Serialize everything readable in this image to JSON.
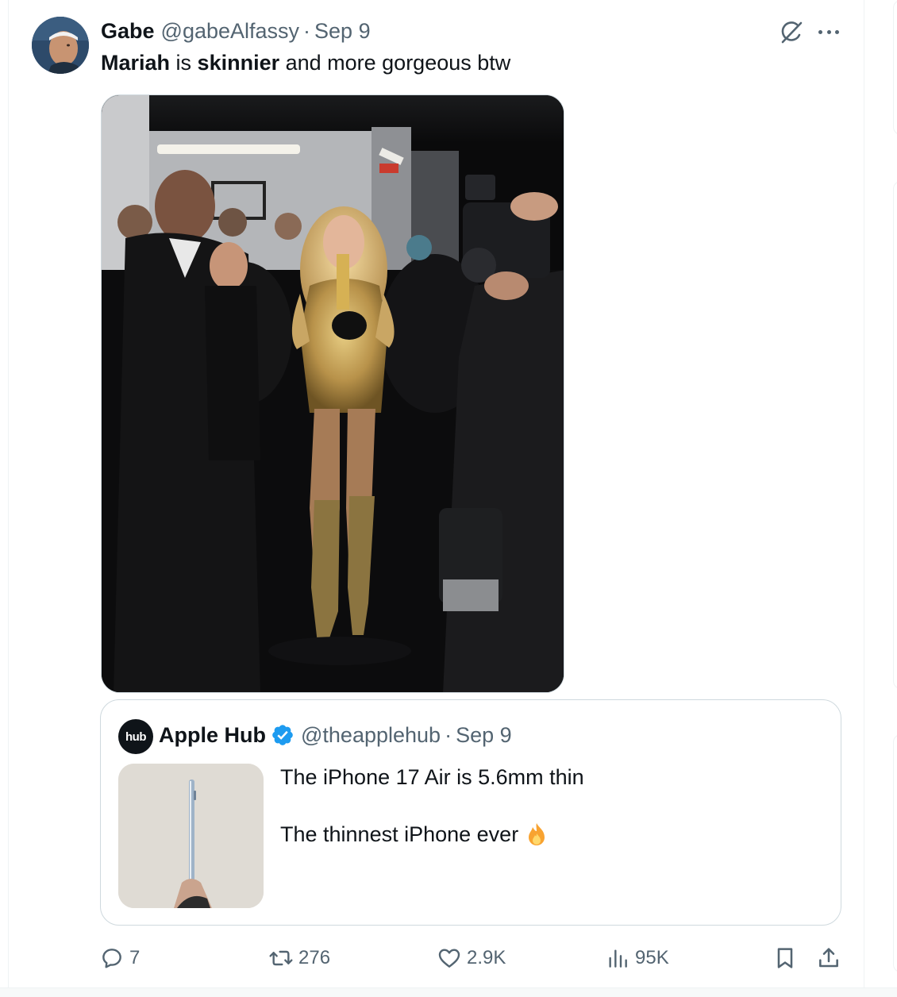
{
  "tweet": {
    "author_name": "Gabe",
    "author_handle": "@gabeAlfassy",
    "separator": "·",
    "date": "Sep 9",
    "text_part1": "Mariah",
    "text_part2": " is ",
    "text_part3": "skinnier",
    "text_part4": " and more gorgeous btw"
  },
  "quoted_tweet": {
    "logo_text": "hub",
    "author_name": "Apple Hub",
    "author_handle": "@theapplehub",
    "separator": "·",
    "date": "Sep 9",
    "line1": "The iPhone 17 Air is 5.6mm thin",
    "line2": "The thinnest iPhone ever",
    "emoji_icon": "fire-icon"
  },
  "actions": {
    "replies": "7",
    "reposts": "276",
    "likes": "2.9K",
    "views": "95K"
  },
  "icons": {
    "grok": "grok-icon",
    "more": "more-icon",
    "reply": "reply-icon",
    "repost": "repost-icon",
    "like": "heart-icon",
    "views": "views-icon",
    "bookmark": "bookmark-icon",
    "share": "share-icon",
    "verified": "verified-badge-icon"
  },
  "colors": {
    "text_primary": "#0f1419",
    "text_secondary": "#536471",
    "border": "#cfd9de",
    "verified_blue": "#1d9bf0"
  }
}
